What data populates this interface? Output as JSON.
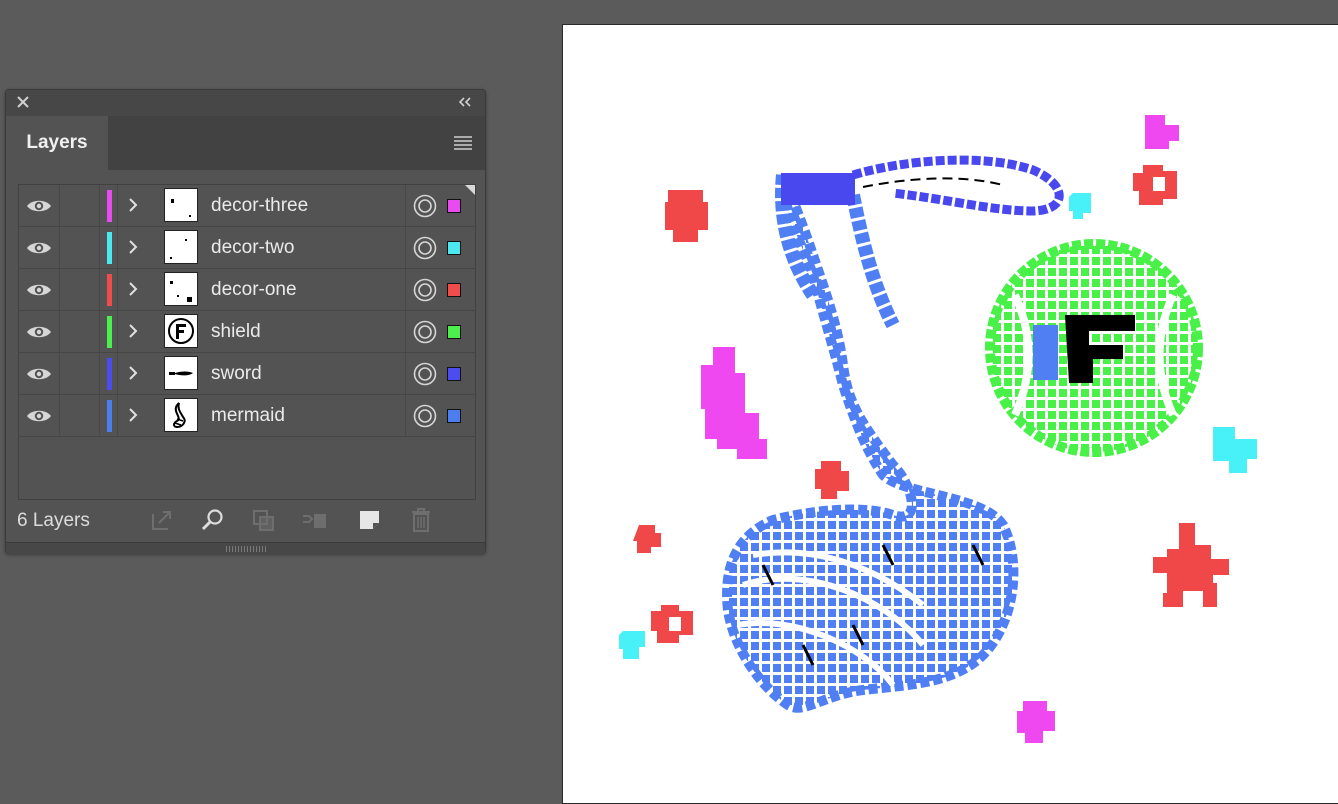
{
  "panel": {
    "tab_label": "Layers",
    "layer_count_label": "6 Layers",
    "icons": {
      "close": "close-icon",
      "collapse": "double-chevron-left-icon",
      "menu": "hamburger-menu-icon",
      "visibility": "eye-icon",
      "expand": "chevron-right-icon",
      "target": "target-circle-icon"
    },
    "footer_buttons": [
      {
        "name": "export-for-screens-button",
        "icon": "export-icon"
      },
      {
        "name": "locate-object-button",
        "icon": "search-icon"
      },
      {
        "name": "make-clipping-mask-button",
        "icon": "clipping-mask-icon"
      },
      {
        "name": "create-sublayer-button",
        "icon": "new-sublayer-icon"
      },
      {
        "name": "create-new-layer-button",
        "icon": "new-layer-icon"
      },
      {
        "name": "delete-layer-button",
        "icon": "trash-icon"
      }
    ],
    "layers": [
      {
        "name": "decor-three",
        "color": "#e84cf0"
      },
      {
        "name": "decor-two",
        "color": "#4ce8f0"
      },
      {
        "name": "decor-one",
        "color": "#f04c4c"
      },
      {
        "name": "shield",
        "color": "#4cf04c"
      },
      {
        "name": "sword",
        "color": "#4c4cf0"
      },
      {
        "name": "mermaid",
        "color": "#4c7ef0"
      }
    ]
  },
  "artboard": {
    "colors": {
      "mermaid": "#4f7ff2",
      "sword": "#4848ee",
      "shield": "#48f048",
      "decor_one": "#f04848",
      "decor_two": "#48f0f8",
      "decor_three": "#f048f0",
      "ink": "#000000"
    }
  }
}
